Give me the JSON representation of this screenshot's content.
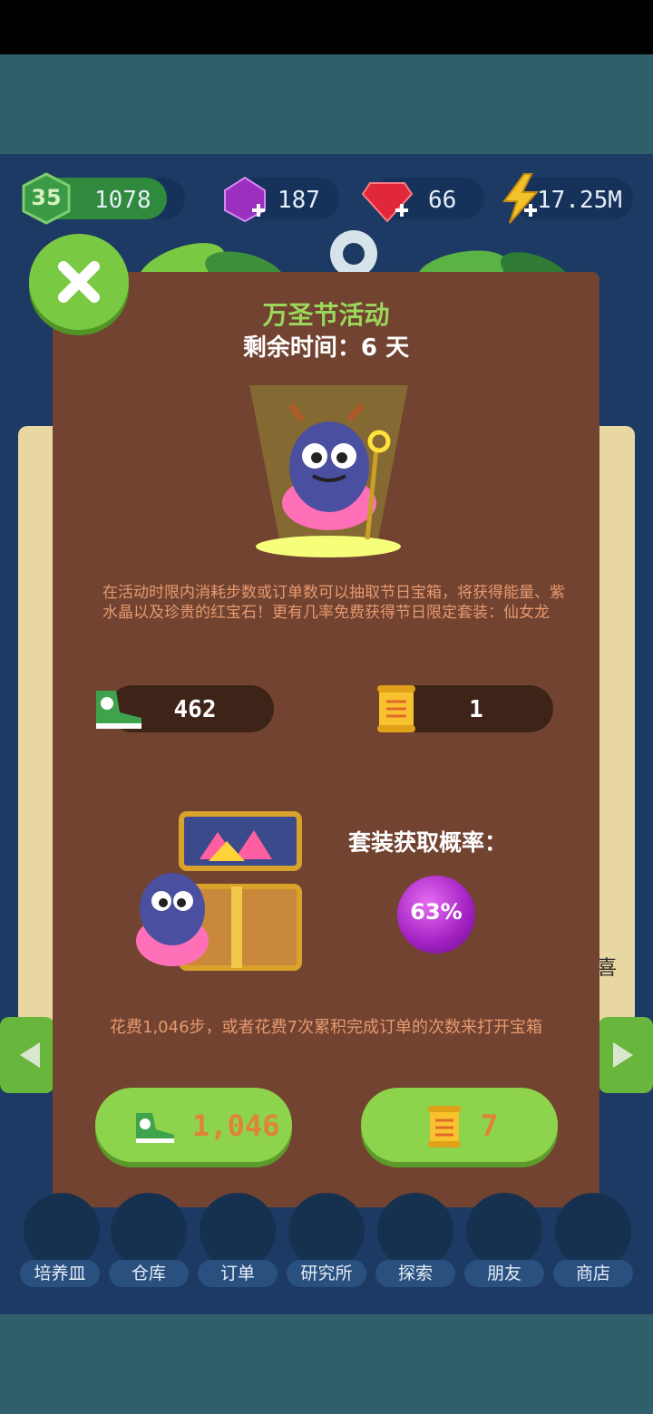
{
  "status_bar": {
    "level": "35",
    "experience": "1078",
    "amethyst": "187",
    "ruby": "66",
    "energy": "17.25M"
  },
  "popup": {
    "title": "万圣节活动",
    "timer": "剩余时间：6 天",
    "description": "在活动时限内消耗步数或订单数可以抽取节日宝箱，将获得能量、紫水晶以及珍贵的红宝石！更有几率免费获得节日限定套装：仙女龙",
    "steps_count": "462",
    "orders_count": "1",
    "set_rate_label": "套装获取概率：",
    "set_rate_value": "63%",
    "cost_description": "花费1,046步，或者花费7次累积完成订单的次数来打开宝箱",
    "steps_cost": "1,046",
    "orders_cost": "7"
  },
  "background_hint": "喜",
  "nav": {
    "items": [
      {
        "label": "培养皿"
      },
      {
        "label": "仓库"
      },
      {
        "label": "订单"
      },
      {
        "label": "研究所"
      },
      {
        "label": "探索"
      },
      {
        "label": "朋友"
      },
      {
        "label": "商店"
      }
    ]
  },
  "colors": {
    "popup_bg": "#724330",
    "accent_green": "#8ed34c",
    "title_green": "#9ad75b",
    "desc_orange": "#e6996f",
    "button_text_orange": "#e0833a"
  }
}
